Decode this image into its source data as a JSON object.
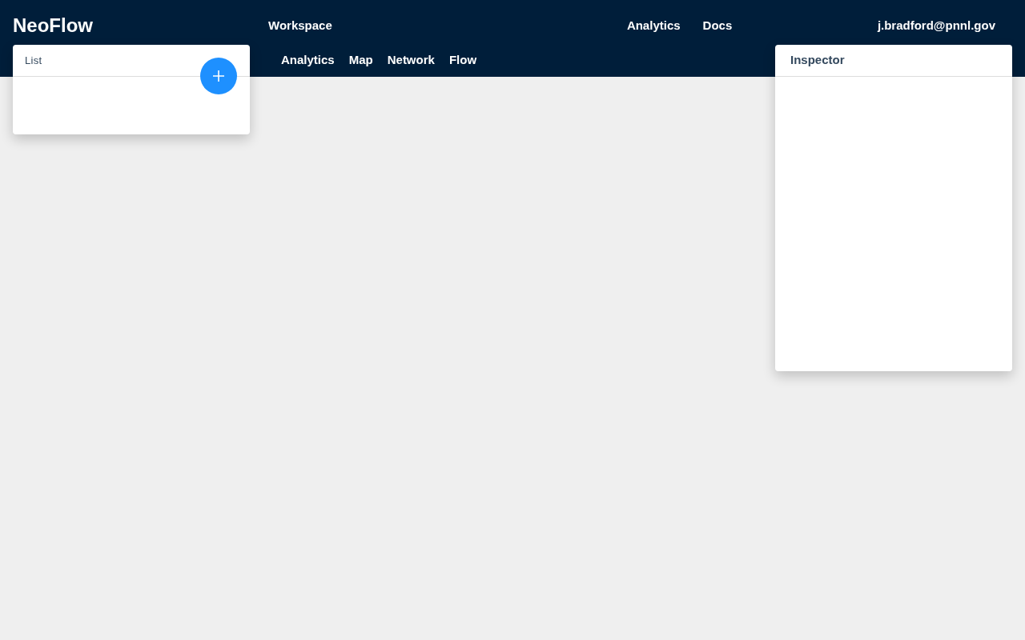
{
  "header": {
    "logo": "NeoFlow",
    "primary_nav": [
      "Workspace"
    ],
    "secondary_nav": [
      "Analytics",
      "Docs"
    ],
    "user": "j.bradford@pnnl.gov",
    "sub_nav": [
      "Analytics",
      "Map",
      "Network",
      "Flow"
    ]
  },
  "list_panel": {
    "title": "List"
  },
  "inspector_panel": {
    "title": "Inspector"
  }
}
